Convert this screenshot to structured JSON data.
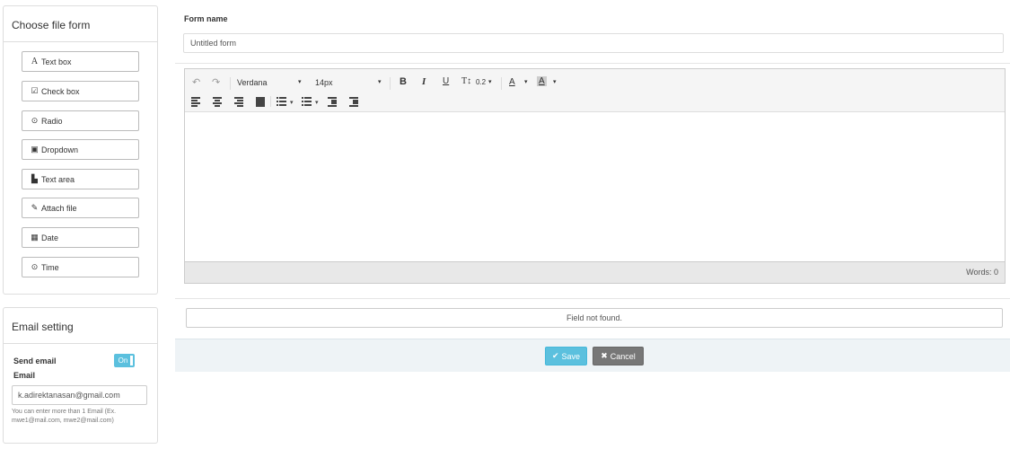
{
  "choose_panel": {
    "title": "Choose file form",
    "items": [
      {
        "label": "Text box",
        "icon": "text-icon",
        "glyph": "A"
      },
      {
        "label": "Check box",
        "icon": "checkbox-icon",
        "glyph": "☑"
      },
      {
        "label": "Radio",
        "icon": "radio-icon",
        "glyph": "⊙"
      },
      {
        "label": "Dropdown",
        "icon": "dropdown-icon",
        "glyph": "▣"
      },
      {
        "label": "Text area",
        "icon": "textarea-icon",
        "glyph": "▙"
      },
      {
        "label": "Attach file",
        "icon": "paperclip-icon",
        "glyph": "✎"
      },
      {
        "label": "Date",
        "icon": "calendar-icon",
        "glyph": "▦"
      },
      {
        "label": "Time",
        "icon": "clock-icon",
        "glyph": "⊙"
      }
    ]
  },
  "email_panel": {
    "title": "Email setting",
    "send_email_label": "Send email",
    "toggle_label": "On",
    "email_label": "Email",
    "email_value": "k.adirektanasan@gmail.com",
    "help_text": "You can enter more than 1 Email (Ex. mwe1@mail.com, mwe2@mail.com)"
  },
  "form": {
    "name_label": "Form name",
    "name_value": "Untitled form"
  },
  "editor": {
    "undo_glyph": "↶",
    "redo_glyph": "↷",
    "font_family": "Verdana",
    "font_size": "14px",
    "bold": "B",
    "italic": "I",
    "underline": "U",
    "line_height_glyph": "T↕",
    "line_height_value": "0.2",
    "dropdown_caret": "▾",
    "font_color_glyph": "A",
    "bg_color_glyph": "A",
    "words_label": "Words: 0"
  },
  "status": {
    "not_found": "Field not found."
  },
  "actions": {
    "save_label": "Save",
    "cancel_label": "Cancel",
    "save_icon": "✔",
    "cancel_icon": "✖"
  },
  "colors": {
    "accent": "#5bc0de",
    "cancel": "#777777",
    "footer_bg": "#eef3f6"
  }
}
